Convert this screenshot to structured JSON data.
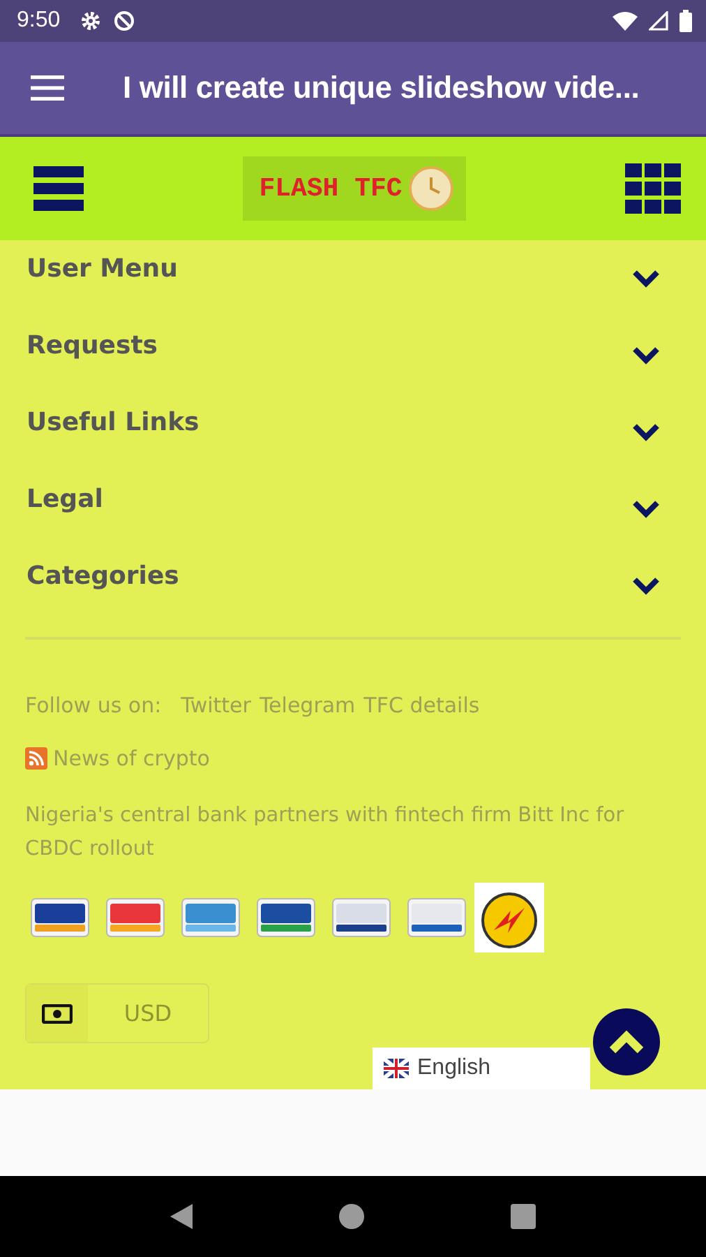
{
  "status_bar": {
    "time": "9:50"
  },
  "app_bar": {
    "title": "I will create unique slideshow vide..."
  },
  "site_header": {
    "logo_text": "FLASH TFC"
  },
  "menu": [
    {
      "label": "User Menu",
      "expanded": false
    },
    {
      "label": "Requests",
      "expanded": false
    },
    {
      "label": "Useful Links",
      "expanded": false
    },
    {
      "label": "Legal",
      "expanded": false
    },
    {
      "label": "Categories",
      "expanded": false
    }
  ],
  "footer": {
    "follow_label": "Follow us on:",
    "social_links": [
      "Twitter",
      "Telegram",
      "TFC details"
    ],
    "feed_link": "News of crypto",
    "news_headline": "Nigeria's central bank partners with fintech firm Bitt Inc for CBDC rollout",
    "currency": "USD"
  },
  "language_selector": {
    "value": "English"
  }
}
